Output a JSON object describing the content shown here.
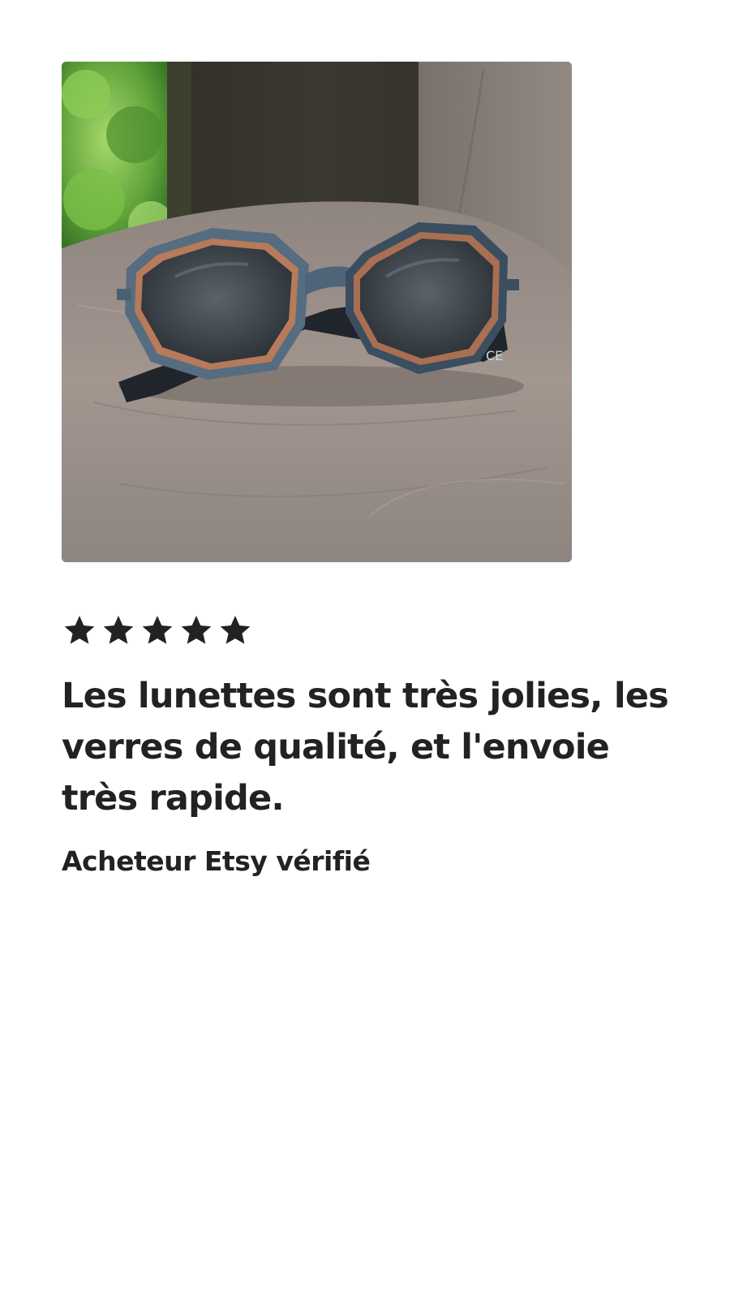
{
  "review": {
    "photo_alt": "Lunettes de soleil",
    "rating": {
      "value": 5,
      "max": 5,
      "icon": "star-icon",
      "color": "#222222"
    },
    "text": "Les lunettes sont très jolies, les verres de qualité, et l'envoie très rapide.",
    "reviewer": "Acheteur Etsy vérifié"
  }
}
